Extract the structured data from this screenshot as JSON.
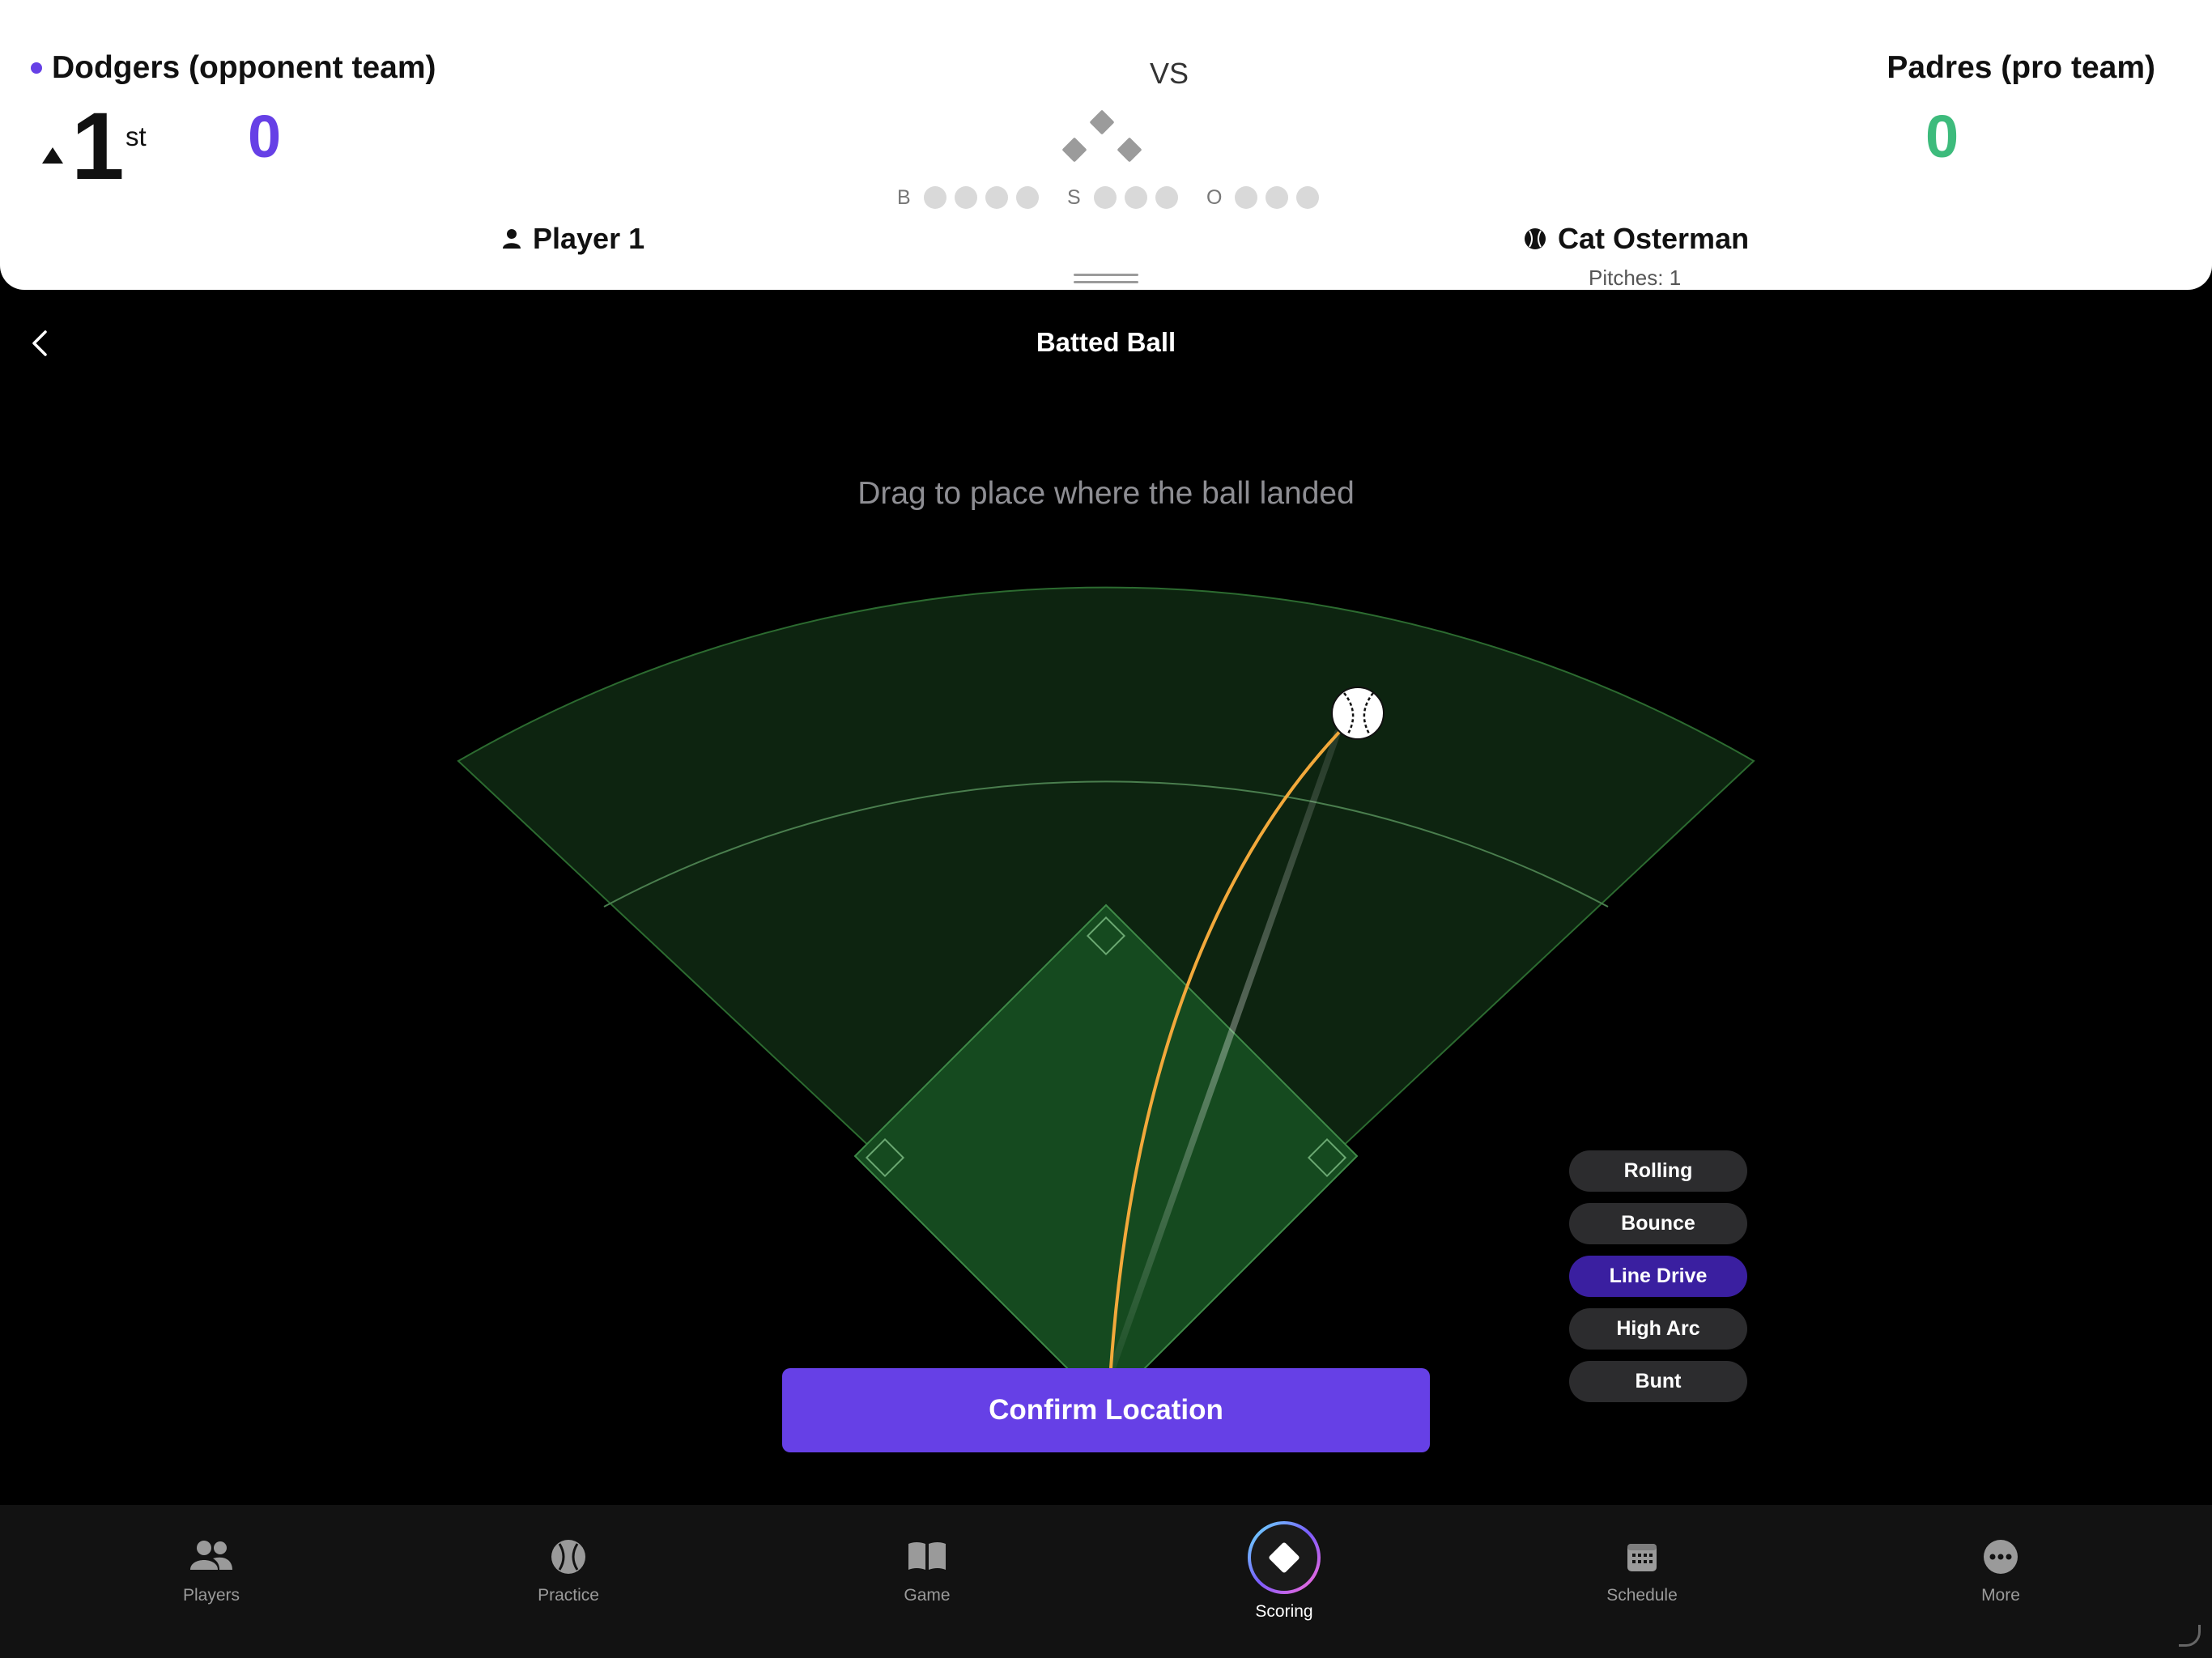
{
  "scoreboard": {
    "away_team": "Dodgers (opponent team)",
    "home_team": "Padres (pro team)",
    "vs": "VS",
    "inning": "1",
    "inning_suffix": "st",
    "away_score": "0",
    "home_score": "0",
    "balls_label": "B",
    "strikes_label": "S",
    "outs_label": "O",
    "balls": 0,
    "strikes": 0,
    "outs": 0,
    "batter": "Player 1",
    "pitcher": "Cat Osterman",
    "pitches": "Pitches: 1",
    "colors": {
      "away": "#6640e6",
      "home": "#3dbb7c"
    }
  },
  "main": {
    "title": "Batted Ball",
    "instruction": "Drag to place where the ball landed",
    "hit_types": [
      {
        "label": "Rolling",
        "active": false
      },
      {
        "label": "Bounce",
        "active": false
      },
      {
        "label": "Line Drive",
        "active": true
      },
      {
        "label": "High Arc",
        "active": false
      },
      {
        "label": "Bunt",
        "active": false
      }
    ],
    "confirm_label": "Confirm Location",
    "accent_color": "#6640e6",
    "trajectory_color": "#f2a93b"
  },
  "tabbar": {
    "tabs": [
      {
        "label": "Players",
        "icon": "players-icon"
      },
      {
        "label": "Practice",
        "icon": "softball-icon"
      },
      {
        "label": "Game",
        "icon": "book-icon"
      },
      {
        "label": "Scoring",
        "icon": "diamond-icon",
        "active": true
      },
      {
        "label": "Schedule",
        "icon": "calendar-icon"
      },
      {
        "label": "More",
        "icon": "more-icon"
      }
    ]
  }
}
